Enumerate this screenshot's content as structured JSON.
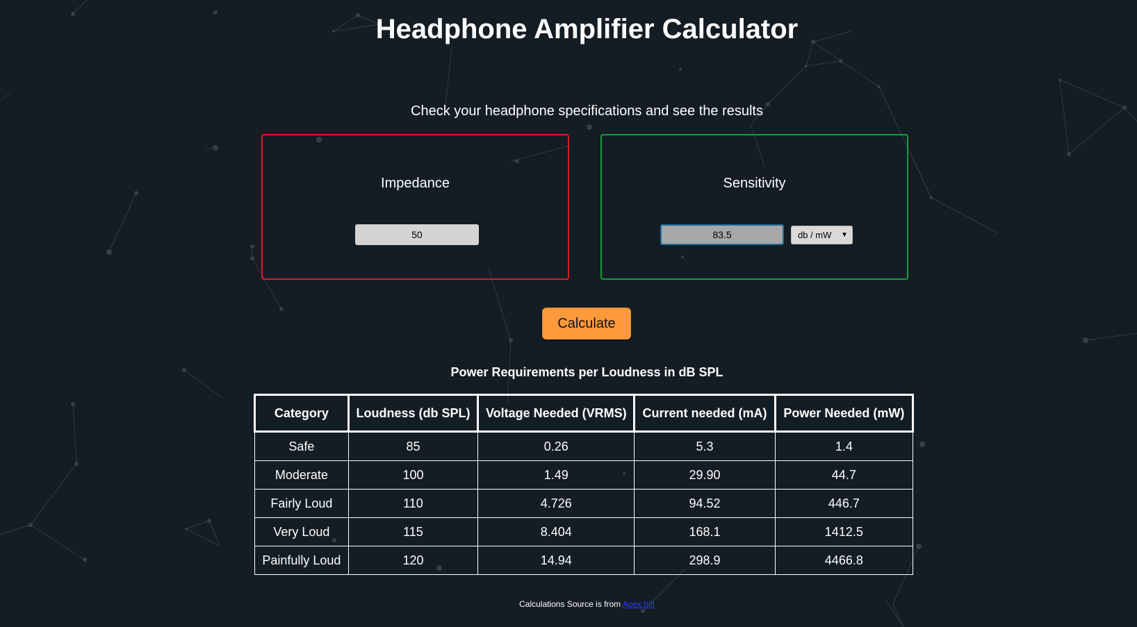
{
  "page": {
    "title": "Headphone Amplifier Calculator",
    "subtitle": "Check your headphone specifications and see the results"
  },
  "impedance": {
    "label": "Impedance",
    "value": "50"
  },
  "sensitivity": {
    "label": "Sensitivity",
    "value": "83.5",
    "unit_selected": "db / mW"
  },
  "calculate_label": "Calculate",
  "results": {
    "title": "Power Requirements per Loudness in dB SPL",
    "headers": [
      "Category",
      "Loudness (db SPL)",
      "Voltage Needed (VRMS)",
      "Current needed (mA)",
      "Power Needed (mW)"
    ],
    "rows": [
      [
        "Safe",
        "85",
        "0.26",
        "5.3",
        "1.4"
      ],
      [
        "Moderate",
        "100",
        "1.49",
        "29.90",
        "44.7"
      ],
      [
        "Fairly Loud",
        "110",
        "4.726",
        "94.52",
        "446.7"
      ],
      [
        "Very Loud",
        "115",
        "8.404",
        "168.1",
        "1412.5"
      ],
      [
        "Painfully Loud",
        "120",
        "14.94",
        "298.9",
        "4466.8"
      ]
    ]
  },
  "footer": {
    "text": "Calculations Source is from",
    "link_text": "Apex hifi"
  },
  "colors": {
    "background": "#141c24",
    "impedance_border": "#d42020",
    "sensitivity_border": "#18a03a",
    "button": "#ff9a3c"
  },
  "icons": {
    "select_caret": "caret-down-icon"
  }
}
